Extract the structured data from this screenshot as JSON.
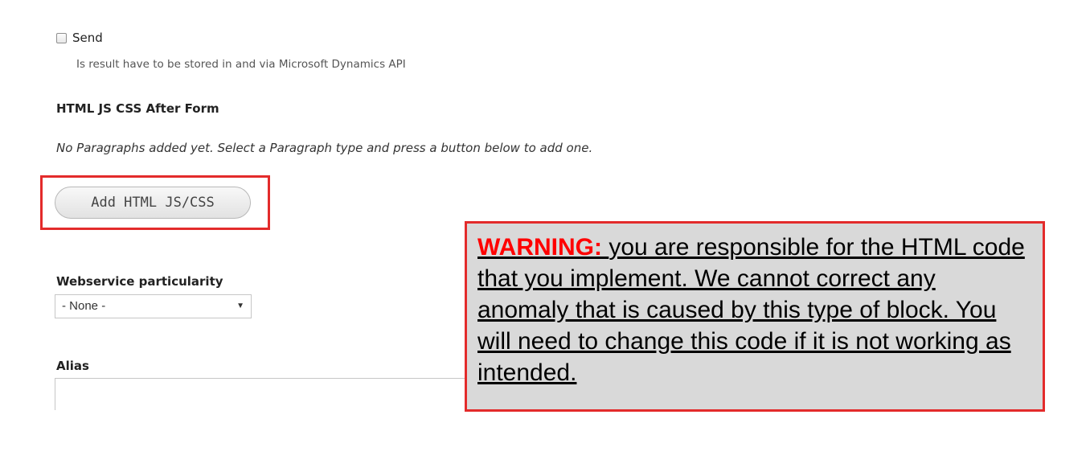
{
  "send_checkbox": {
    "label": "Send",
    "checked": false,
    "description": "Is result have to be stored in and via Microsoft Dynamics API"
  },
  "paragraphs_section": {
    "title": "HTML JS CSS After Form",
    "empty_message": "No Paragraphs added yet. Select a Paragraph type and press a button below to add one.",
    "add_button_label": "Add HTML JS/CSS"
  },
  "webservice": {
    "label": "Webservice particularity",
    "selected": "- None -"
  },
  "alias": {
    "label": "Alias",
    "value": ""
  },
  "warning": {
    "prefix": "WARNING:",
    "message": "you are responsible for the HTML code that you implement. We cannot correct any anomaly that is caused by this type of block. You will need to change this code if it is not working as intended."
  },
  "colors": {
    "highlight_border": "#e32b2b",
    "warning_background": "#d9d9d9",
    "warning_prefix": "#ff0000"
  },
  "icons": {
    "select_arrow": "chevron-down-icon"
  }
}
